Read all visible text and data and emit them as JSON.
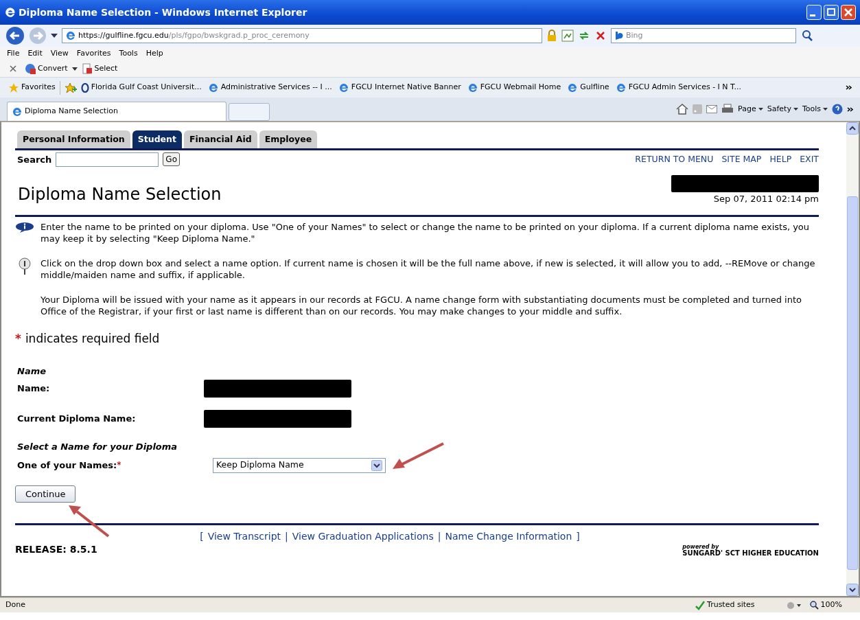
{
  "window": {
    "title": "Diploma Name Selection - Windows Internet Explorer"
  },
  "address_bar": {
    "url_host": "https://gulfline.fgcu.edu",
    "url_path": "/pls/fgpo/bwskgrad.p_proc_ceremony",
    "search_placeholder": "Bing"
  },
  "menu": [
    "File",
    "Edit",
    "View",
    "Favorites",
    "Tools",
    "Help"
  ],
  "command_bar": [
    "Convert",
    "Select"
  ],
  "favorites_bar": {
    "label": "Favorites",
    "items": [
      "Florida Gulf Coast Universit...",
      "Administrative Services -- I ...",
      "FGCU Internet Native Banner",
      "FGCU Webmail Home",
      "Gulfline",
      "FGCU Admin Services - I N T..."
    ]
  },
  "browser_tab": {
    "title": "Diploma Name Selection"
  },
  "tool_menus": [
    "Page",
    "Safety",
    "Tools"
  ],
  "page": {
    "tabs": [
      {
        "label": "Personal Information",
        "selected": false
      },
      {
        "label": "Student",
        "selected": true
      },
      {
        "label": "Financial Aid",
        "selected": false
      },
      {
        "label": "Employee",
        "selected": false
      }
    ],
    "search": {
      "label": "Search",
      "button": "Go"
    },
    "nav_links": [
      "RETURN TO MENU",
      "SITE MAP",
      "HELP",
      "EXIT"
    ],
    "heading": "Diploma Name Selection",
    "datetime": "Sep 07, 2011 02:14 pm",
    "notes": [
      {
        "kind": "info",
        "text": "Enter the name to be printed on your diploma. Use \"One of your Names\" to select or change the name to be printed on your diploma. If a current diploma name exists, you may keep it by selecting \"Keep Diploma Name.\""
      },
      {
        "kind": "help",
        "text": "Click on the drop down box and select a name option. If current name is chosen it will be the full name above, if new is selected, it will allow you to add, --REMove or change middle/maiden name and suffix, if applicable."
      },
      {
        "kind": "plain",
        "text": "Your Diploma will be issued with your name as it appears in our records at FGCU. A name change form with substantiating documents must be completed and turned into Office of the Registrar, if your first or last name is different than on our records. You may make changes to your middle and suffix."
      }
    ],
    "required_note": {
      "mark": "*",
      "text": "indicates required field"
    },
    "name_section": {
      "heading": "Name",
      "fields": [
        "Name:",
        "Current Diploma Name:"
      ]
    },
    "select_section": {
      "heading": "Select a Name for your Diploma",
      "label": "One of your Names:",
      "required_mark": "*",
      "value": "Keep Diploma Name"
    },
    "continue_button": "Continue",
    "footer_links": {
      "open": "[",
      "items": [
        "View Transcript",
        "View Graduation Applications",
        "Name Change Information"
      ],
      "separator": "|",
      "close": "]"
    },
    "release": "RELEASE: 8.5.1",
    "powered_by": {
      "small": "powered by",
      "brand": "SUNGARD' SCT HIGHER EDUCATION"
    }
  },
  "status_bar": {
    "status": "Done",
    "zone": "Trusted sites",
    "zoom": "100%"
  }
}
